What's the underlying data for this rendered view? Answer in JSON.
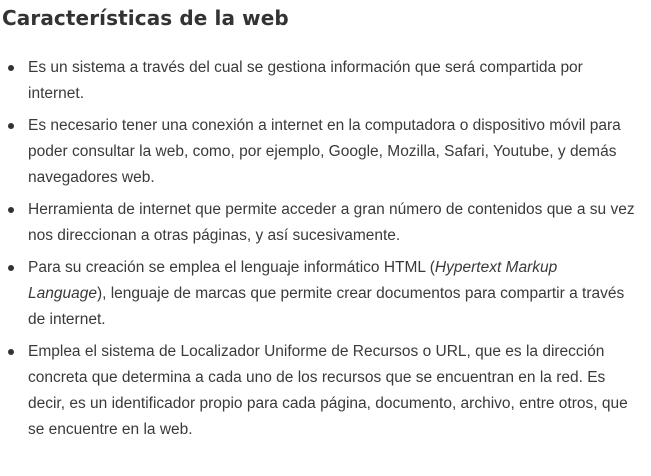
{
  "heading": "Características de la web",
  "items": [
    {
      "text": "Es un sistema a través del cual se gestiona información que será compartida por internet."
    },
    {
      "text": "Es necesario tener una conexión a internet en la computadora o dispositivo móvil para poder consultar la web, como, por ejemplo, Google, Mozilla, Safari, Youtube, y demás navegadores web."
    },
    {
      "text": "Herramienta de internet que permite acceder a gran número de contenidos que a su vez nos direccionan a otras páginas, y así sucesivamente."
    },
    {
      "before": "Para su creación se emplea el lenguaje informático HTML (",
      "italic": "Hypertext Markup Language",
      "after": "), lenguaje de marcas que permite crear documentos para compartir a través de internet."
    },
    {
      "text": "Emplea el sistema de Localizador Uniforme de Recursos o URL, que es la dirección concreta que determina a cada uno de los recursos que se encuentran en la red. Es decir, es un identificador propio para cada página, documento, archivo, entre otros, que se encuentre en la web."
    }
  ]
}
